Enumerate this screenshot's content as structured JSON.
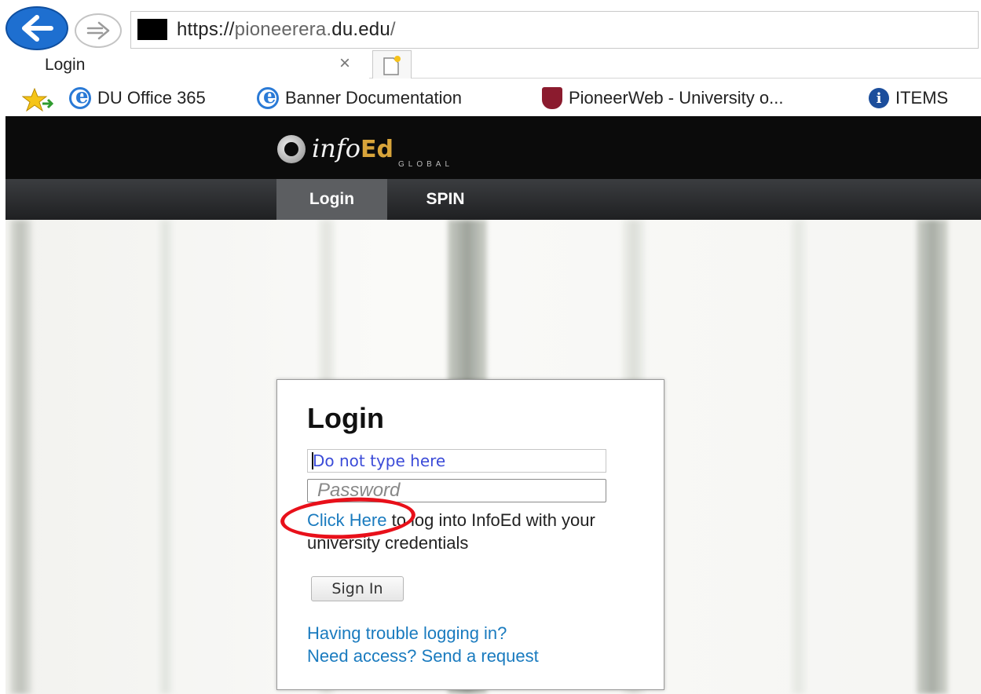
{
  "browser": {
    "url_prefix": "https://",
    "url_host_dim": "pioneerera.",
    "url_host": "du.edu",
    "url_suffix": "/",
    "tab_title": "Login",
    "tab_close": "×",
    "favorites": [
      {
        "label": "DU Office 365",
        "icon": "ie-icon"
      },
      {
        "label": "Banner Documentation",
        "icon": "ie-icon"
      },
      {
        "label": "PioneerWeb - University o...",
        "icon": "shield-icon"
      },
      {
        "label": "ITEMS",
        "icon": "info-icon"
      }
    ]
  },
  "site": {
    "logo_info": "info",
    "logo_ed": "Ed",
    "logo_sub": "GLOBAL",
    "nav": [
      {
        "label": "Login",
        "active": true
      },
      {
        "label": "SPIN",
        "active": false
      }
    ]
  },
  "login": {
    "title": "Login",
    "username_value": "Do not type here",
    "password_placeholder": "Password",
    "click_here": "Click Here",
    "sso_text": " to log into InfoEd with your university credentials",
    "sign_in": "Sign In",
    "trouble": "Having trouble logging in?",
    "access": "Need access? Send a request"
  },
  "colors": {
    "accent_link": "#1a7bbf",
    "annotation_red": "#e8101a",
    "header_bg": "#0b0b0b",
    "logo_gold": "#d8a43a"
  }
}
